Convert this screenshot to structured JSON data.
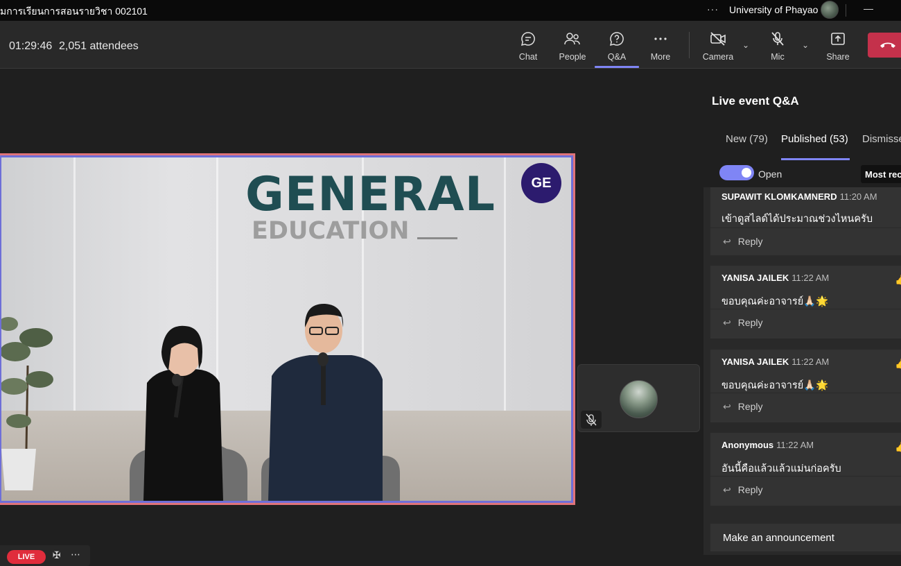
{
  "window": {
    "title": "มการเรียนการสอนรายวิชา 002101",
    "menu_dots": "···",
    "organization": "University of Phayao",
    "minimize": "—"
  },
  "meeting": {
    "timer": "01:29:46",
    "attendees": "2,051 attendees"
  },
  "toolbar": {
    "chat": "Chat",
    "people": "People",
    "qa": "Q&A",
    "more": "More",
    "camera": "Camera",
    "mic": "Mic",
    "share": "Share"
  },
  "stage": {
    "banner_title": "GENERAL",
    "banner_subtitle": "EDUCATION",
    "logo_text": "GE",
    "live_label": "LIVE"
  },
  "qa": {
    "header": "Live event Q&A",
    "tabs": [
      {
        "label": "New (79)"
      },
      {
        "label": "Published (53)"
      },
      {
        "label": "Dismissed"
      }
    ],
    "toggle_label": "Open",
    "sort_label": "Most recent",
    "reply_label": "Reply",
    "questions": [
      {
        "author": "SUPAWIT KLOMKAMNERD",
        "time": "11:20 AM",
        "message": "เข้าดูสไลด์ได้ประมาณช่วงไหนครับ"
      },
      {
        "author": "YANISA JAILEK",
        "time": "11:22 AM",
        "message": "ขอบคุณค่ะอาจารย์🙏🏻🌟"
      },
      {
        "author": "YANISA JAILEK",
        "time": "11:22 AM",
        "message": "ขอบคุณค่ะอาจารย์🙏🏻🌟"
      },
      {
        "author": "Anonymous",
        "time": "11:22 AM",
        "message": "อันนี้คือแล้วแล้วแม่นก่อครับ"
      }
    ],
    "announcement": "Make an announcement"
  },
  "colors": {
    "accent": "#7f85f5",
    "leave": "#c4314b",
    "live": "#e02d3c",
    "frame_outer": "#e0747a",
    "frame_inner": "#6e6fd8"
  }
}
